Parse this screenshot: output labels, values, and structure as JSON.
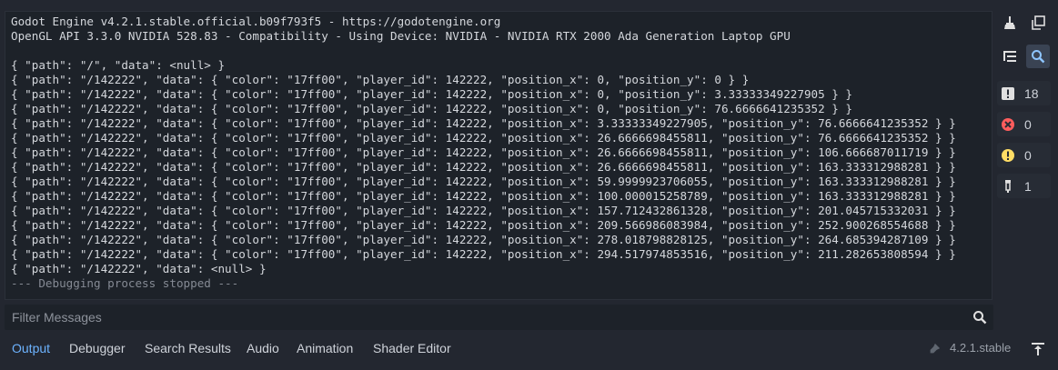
{
  "output": {
    "lines": [
      {
        "text": "Godot Engine v4.2.1.stable.official.b09f793f5 - https://godotengine.org",
        "style": "normal"
      },
      {
        "text": "OpenGL API 3.3.0 NVIDIA 528.83 - Compatibility - Using Device: NVIDIA - NVIDIA RTX 2000 Ada Generation Laptop GPU",
        "style": "normal"
      },
      {
        "text": "",
        "style": "blank"
      },
      {
        "text": "{ \"path\": \"/\", \"data\": <null> }",
        "style": "normal"
      },
      {
        "text": "{ \"path\": \"/142222\", \"data\": { \"color\": \"17ff00\", \"player_id\": 142222, \"position_x\": 0, \"position_y\": 0 } }",
        "style": "normal"
      },
      {
        "text": "{ \"path\": \"/142222\", \"data\": { \"color\": \"17ff00\", \"player_id\": 142222, \"position_x\": 0, \"position_y\": 3.33333349227905 } }",
        "style": "normal"
      },
      {
        "text": "{ \"path\": \"/142222\", \"data\": { \"color\": \"17ff00\", \"player_id\": 142222, \"position_x\": 0, \"position_y\": 76.6666641235352 } }",
        "style": "normal"
      },
      {
        "text": "{ \"path\": \"/142222\", \"data\": { \"color\": \"17ff00\", \"player_id\": 142222, \"position_x\": 3.33333349227905, \"position_y\": 76.6666641235352 } }",
        "style": "normal"
      },
      {
        "text": "{ \"path\": \"/142222\", \"data\": { \"color\": \"17ff00\", \"player_id\": 142222, \"position_x\": 26.6666698455811, \"position_y\": 76.6666641235352 } }",
        "style": "normal"
      },
      {
        "text": "{ \"path\": \"/142222\", \"data\": { \"color\": \"17ff00\", \"player_id\": 142222, \"position_x\": 26.6666698455811, \"position_y\": 106.666687011719 } }",
        "style": "normal"
      },
      {
        "text": "{ \"path\": \"/142222\", \"data\": { \"color\": \"17ff00\", \"player_id\": 142222, \"position_x\": 26.6666698455811, \"position_y\": 163.333312988281 } }",
        "style": "normal"
      },
      {
        "text": "{ \"path\": \"/142222\", \"data\": { \"color\": \"17ff00\", \"player_id\": 142222, \"position_x\": 59.9999923706055, \"position_y\": 163.333312988281 } }",
        "style": "normal"
      },
      {
        "text": "{ \"path\": \"/142222\", \"data\": { \"color\": \"17ff00\", \"player_id\": 142222, \"position_x\": 100.000015258789, \"position_y\": 163.333312988281 } }",
        "style": "normal"
      },
      {
        "text": "{ \"path\": \"/142222\", \"data\": { \"color\": \"17ff00\", \"player_id\": 142222, \"position_x\": 157.712432861328, \"position_y\": 201.045715332031 } }",
        "style": "normal"
      },
      {
        "text": "{ \"path\": \"/142222\", \"data\": { \"color\": \"17ff00\", \"player_id\": 142222, \"position_x\": 209.566986083984, \"position_y\": 252.900268554688 } }",
        "style": "normal"
      },
      {
        "text": "{ \"path\": \"/142222\", \"data\": { \"color\": \"17ff00\", \"player_id\": 142222, \"position_x\": 278.018798828125, \"position_y\": 264.685394287109 } }",
        "style": "normal"
      },
      {
        "text": "{ \"path\": \"/142222\", \"data\": { \"color\": \"17ff00\", \"player_id\": 142222, \"position_x\": 294.517974853516, \"position_y\": 211.282653808594 } }",
        "style": "normal"
      },
      {
        "text": "{ \"path\": \"/142222\", \"data\": <null> }",
        "style": "normal"
      },
      {
        "text": "--- Debugging process stopped ---",
        "style": "dim"
      }
    ]
  },
  "toolbar": {
    "clear_icon": "broom-icon",
    "copy_icon": "copy-icon",
    "collapse_icon": "collapse-lines-icon",
    "filter_toggle_icon": "search-icon",
    "counts": [
      {
        "name": "messages",
        "icon": "info-icon",
        "count": "18",
        "color": "#e0e0e0"
      },
      {
        "name": "errors",
        "icon": "error-icon",
        "count": "0",
        "color": "#ff5d5d"
      },
      {
        "name": "warnings",
        "icon": "warning-icon",
        "count": "0",
        "color": "#ffdd65"
      },
      {
        "name": "editor",
        "icon": "editor-icon",
        "count": "1",
        "color": "#e0e0e0"
      }
    ]
  },
  "filter": {
    "placeholder": "Filter Messages"
  },
  "bottom_tabs": [
    {
      "label": "Output",
      "active": true
    },
    {
      "label": "Debugger",
      "active": false
    },
    {
      "label": "Search Results",
      "active": false
    },
    {
      "label": "Audio",
      "active": false
    },
    {
      "label": "Animation",
      "active": false
    },
    {
      "label": "Shader Editor",
      "active": false
    }
  ],
  "version": "4.2.1.stable",
  "colors": {
    "accent": "#6db3ff",
    "panel_bg": "#1d2229",
    "editor_bg": "#232730"
  }
}
